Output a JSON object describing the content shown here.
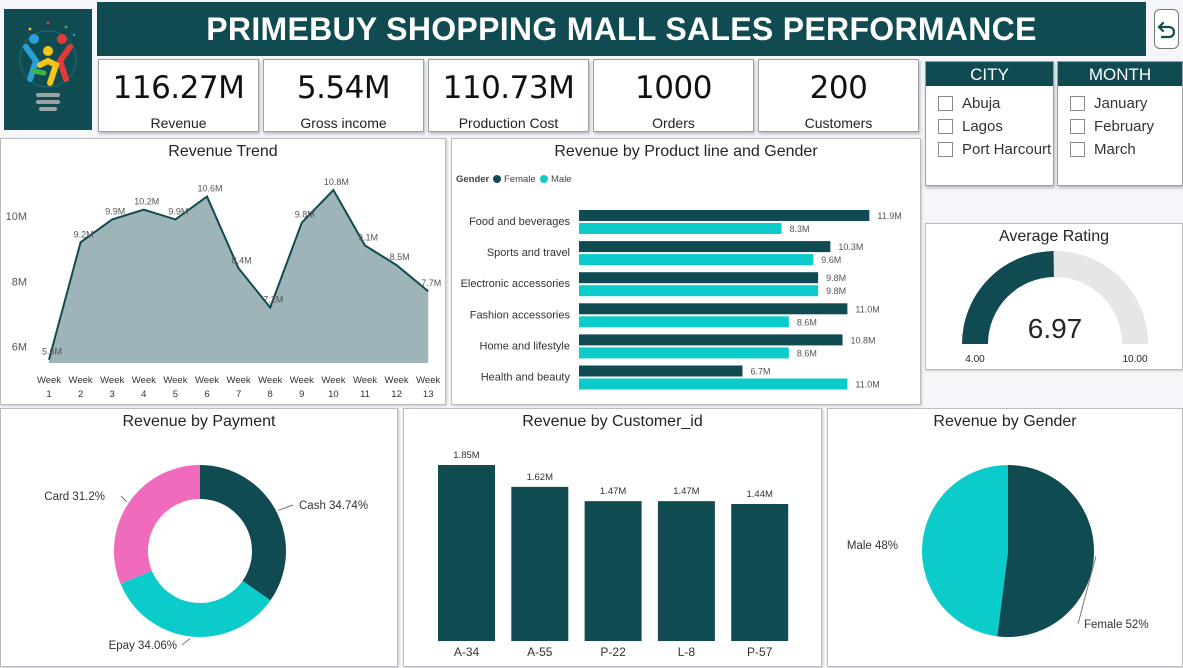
{
  "header": {
    "title": "PRIMEBUY SHOPPING MALL SALES PERFORMANCE"
  },
  "kpis": [
    {
      "value": "116.27M",
      "label": "Revenue"
    },
    {
      "value": "5.54M",
      "label": "Gross income"
    },
    {
      "value": "110.73M",
      "label": "Production Cost"
    },
    {
      "value": "1000",
      "label": "Orders"
    },
    {
      "value": "200",
      "label": "Customers"
    }
  ],
  "filters": {
    "city": {
      "title": "CITY",
      "options": [
        "Abuja",
        "Lagos",
        "Port Harcourt"
      ]
    },
    "month": {
      "title": "MONTH",
      "options": [
        "January",
        "February",
        "March"
      ]
    }
  },
  "icons": {
    "back": "back-arrow-icon",
    "logo": "lightbulb-people-logo-icon"
  },
  "colors": {
    "dark_teal": "#104b52",
    "cyan": "#0ccbcb",
    "pink": "#f06bbb",
    "area_fill": "#9fb4b9",
    "gauge_track": "#e6e6e6"
  },
  "chart_data": [
    {
      "type": "area",
      "title": "Revenue Trend",
      "categories": [
        "Week 1",
        "Week 2",
        "Week 3",
        "Week 4",
        "Week 5",
        "Week 6",
        "Week 7",
        "Week 8",
        "Week 9",
        "Week 10",
        "Week 11",
        "Week 12",
        "Week 13"
      ],
      "values": [
        5.6,
        9.2,
        9.9,
        10.2,
        9.9,
        10.6,
        8.4,
        7.2,
        9.8,
        10.8,
        9.1,
        8.5,
        7.7
      ],
      "data_labels": [
        "5.6M",
        "9.2M",
        "9.9M",
        "10.2M",
        "9.9M",
        "10.6M",
        "8.4M",
        "7.2M",
        "9.8M",
        "10.8M",
        "9.1M",
        "8.5M",
        "7.7M"
      ],
      "y_ticks": [
        {
          "value": 6,
          "label": "6M"
        },
        {
          "value": 8,
          "label": "8M"
        },
        {
          "value": 10,
          "label": "10M"
        }
      ],
      "ylim": [
        5.5,
        11.2
      ]
    },
    {
      "type": "bar",
      "orientation": "horizontal",
      "title": "Revenue by Product line and Gender",
      "legend_title": "Gender",
      "categories": [
        "Food and beverages",
        "Sports and travel",
        "Electronic accessories",
        "Fashion accessories",
        "Home and lifestyle",
        "Health and beauty"
      ],
      "series": [
        {
          "name": "Female",
          "values": [
            11.9,
            10.3,
            9.8,
            11.0,
            10.8,
            6.7
          ],
          "labels": [
            "11.9M",
            "10.3M",
            "9.8M",
            "11.0M",
            "10.8M",
            "6.7M"
          ]
        },
        {
          "name": "Male",
          "values": [
            8.3,
            9.6,
            9.8,
            8.6,
            8.6,
            11.0
          ],
          "labels": [
            "8.3M",
            "9.6M",
            "9.8M",
            "8.6M",
            "8.6M",
            "11.0M"
          ]
        }
      ],
      "xlim": [
        0,
        12.5
      ],
      "legend": "top-left"
    },
    {
      "type": "gauge",
      "title": "Average Rating",
      "value": 6.97,
      "value_label": "6.97",
      "min": 4,
      "max": 10,
      "min_label": "4.00",
      "max_label": "10.00"
    },
    {
      "type": "pie",
      "variant": "donut",
      "title": "Revenue by Payment",
      "slices": [
        {
          "name": "Cash",
          "value": 34.74,
          "label": "Cash 34.74%",
          "color": "#104b52"
        },
        {
          "name": "Epay",
          "value": 34.06,
          "label": "Epay 34.06%",
          "color": "#0ccbcb"
        },
        {
          "name": "Card",
          "value": 31.2,
          "label": "Card 31.2%",
          "color": "#f06bbb"
        }
      ]
    },
    {
      "type": "bar",
      "title": "Revenue by Customer_id",
      "categories": [
        "A-34",
        "A-55",
        "P-22",
        "L-8",
        "P-57"
      ],
      "values": [
        1.85,
        1.62,
        1.47,
        1.47,
        1.44
      ],
      "labels": [
        "1.85M",
        "1.62M",
        "1.47M",
        "1.47M",
        "1.44M"
      ],
      "ylim": [
        0,
        1.85
      ]
    },
    {
      "type": "pie",
      "title": "Revenue by Gender",
      "slices": [
        {
          "name": "Female",
          "value": 52,
          "label": "Female 52%",
          "color": "#104b52"
        },
        {
          "name": "Male",
          "value": 48,
          "label": "Male 48%",
          "color": "#0ccbcb"
        }
      ]
    }
  ]
}
